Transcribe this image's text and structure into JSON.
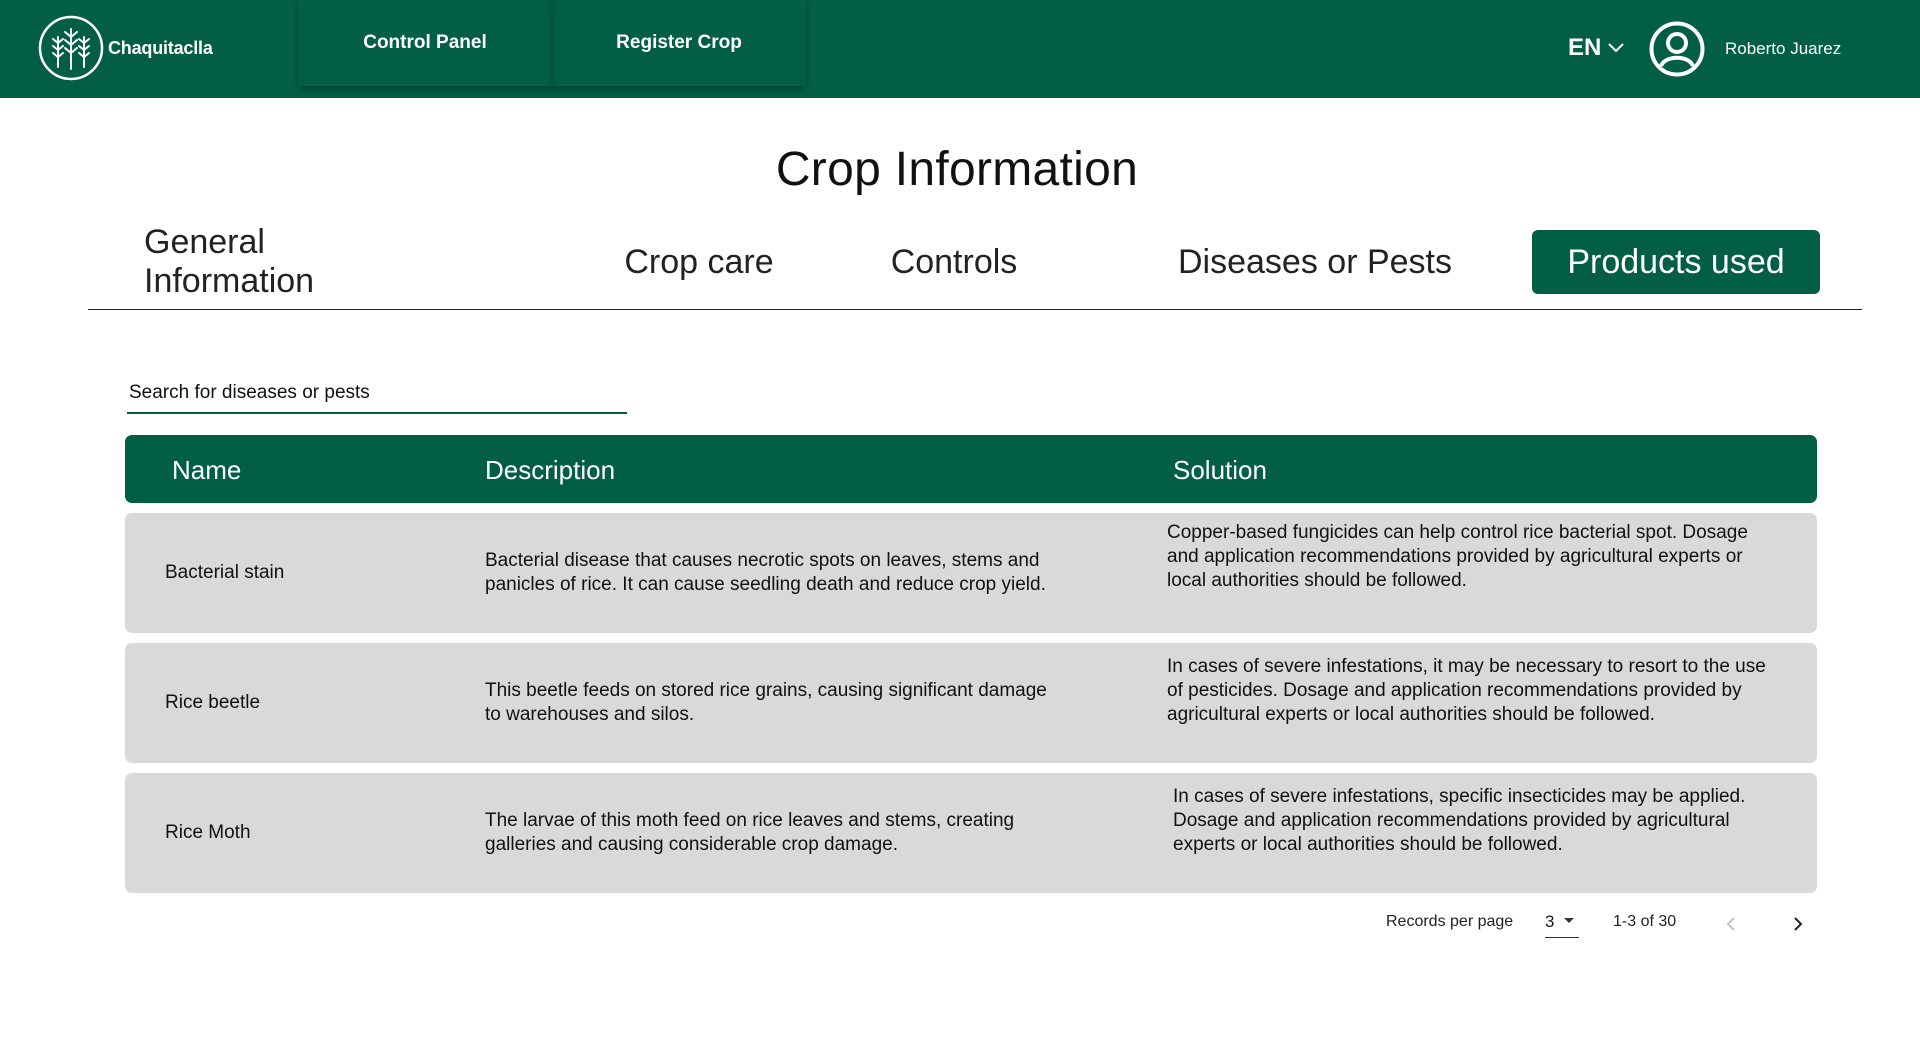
{
  "header": {
    "brand": "Chaquitaclla",
    "nav": [
      "Control Panel",
      "Register Crop"
    ],
    "language": "EN",
    "user_name": "Roberto Juarez"
  },
  "page": {
    "title": "Crop Information",
    "tabs": [
      "General Information",
      "Crop care",
      "Controls",
      "Diseases or Pests",
      "Products used"
    ],
    "active_tab": "Products used"
  },
  "search": {
    "placeholder": "Search for diseases or pests"
  },
  "table": {
    "columns": [
      "Name",
      "Description",
      "Solution"
    ],
    "rows": [
      {
        "name": "Bacterial stain",
        "description": "Bacterial disease that causes necrotic spots on leaves, stems and panicles of rice. It can cause seedling death and reduce crop yield.",
        "solution": "Copper-based fungicides can help control rice bacterial spot. Dosage and application recommendations provided by agricultural experts or local authorities should be followed."
      },
      {
        "name": "Rice beetle",
        "description": "This beetle feeds on stored rice grains, causing significant damage to warehouses and silos.",
        "solution": "In cases of severe infestations, it may be necessary to resort to the use of pesticides. Dosage and application recommendations provided by agricultural experts or local authorities should be followed."
      },
      {
        "name": "Rice Moth",
        "description": "The larvae of this moth feed on rice leaves and stems, creating galleries and causing considerable crop damage.",
        "solution": "In cases of severe infestations, specific insecticides may be applied. Dosage and application recommendations provided by agricultural experts or local authorities should be followed."
      }
    ]
  },
  "pagination": {
    "label": "Records per page",
    "per_page": "3",
    "range": "1-3 of 30"
  },
  "colors": {
    "primary": "#025f43",
    "row_bg": "#d9d9d9"
  }
}
